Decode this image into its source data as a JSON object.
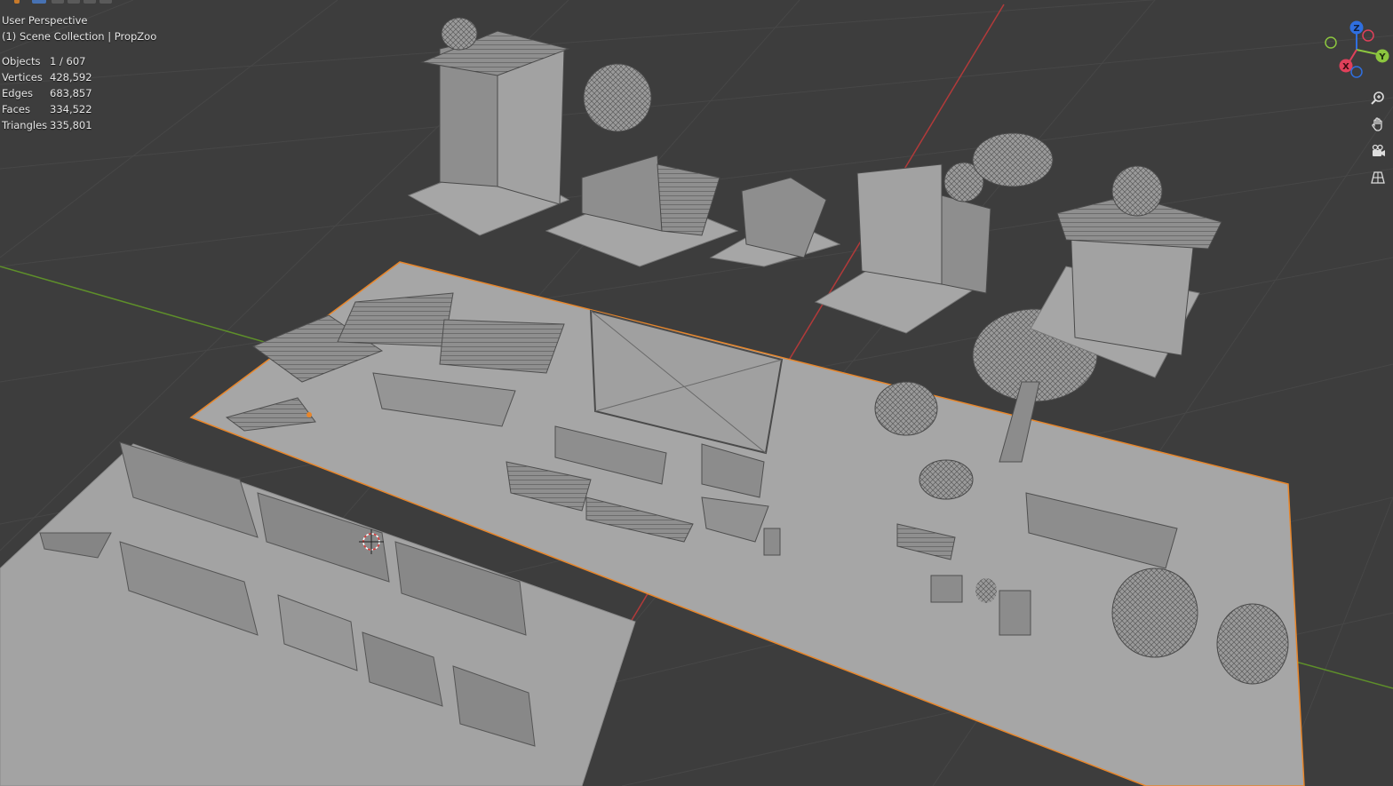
{
  "viewport": {
    "view_name": "User Perspective",
    "collection": "(1) Scene Collection | PropZoo",
    "stats": [
      {
        "label": "Objects",
        "value": "1 / 607"
      },
      {
        "label": "Vertices",
        "value": "428,592"
      },
      {
        "label": "Edges",
        "value": "683,857"
      },
      {
        "label": "Faces",
        "value": "334,522"
      },
      {
        "label": "Triangles",
        "value": "335,801"
      }
    ]
  },
  "gizmo": {
    "axes": [
      {
        "label": "Z",
        "color": "#2f6fe0"
      },
      {
        "label": "Y",
        "color": "#8cc63f"
      },
      {
        "label": "X",
        "color": "#e0405a"
      }
    ]
  },
  "nav_buttons": [
    {
      "name": "zoom-icon"
    },
    {
      "name": "hand-icon"
    },
    {
      "name": "camera-icon"
    },
    {
      "name": "grid-icon"
    }
  ],
  "colors": {
    "background": "#3d3d3d",
    "grid": "#454545",
    "selection_outline": "#e8862a",
    "x_axis": "#b23a3a",
    "y_axis": "#5e8f2a",
    "model": "#9d9d9d"
  }
}
